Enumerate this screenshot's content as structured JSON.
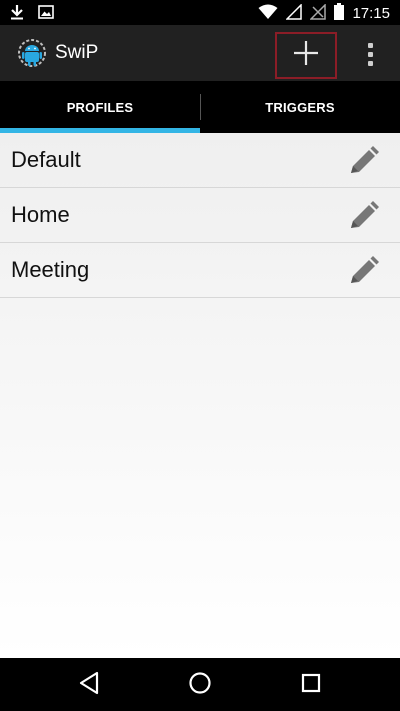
{
  "status_bar": {
    "time": "17:15",
    "icons": [
      "download-icon",
      "image-icon",
      "wifi-icon",
      "signal-icon",
      "no-sim-icon",
      "battery-icon"
    ]
  },
  "action_bar": {
    "title": "SwiP",
    "logo_icon": "android-robot-icon",
    "add_icon": "plus-icon",
    "overflow_icon": "overflow-menu-icon"
  },
  "tabs": [
    {
      "label": "PROFILES",
      "selected": true
    },
    {
      "label": "TRIGGERS",
      "selected": false
    }
  ],
  "profiles": [
    {
      "name": "Default",
      "action_icon": "pencil-icon"
    },
    {
      "name": "Home",
      "action_icon": "pencil-icon"
    },
    {
      "name": "Meeting",
      "action_icon": "pencil-icon"
    }
  ],
  "nav_bar": {
    "icons": [
      "back-icon",
      "home-icon",
      "recents-icon"
    ]
  },
  "colors": {
    "tab_indicator": "#33b5e5",
    "highlight_border": "#8c1d27",
    "action_bar_bg": "#212121"
  }
}
